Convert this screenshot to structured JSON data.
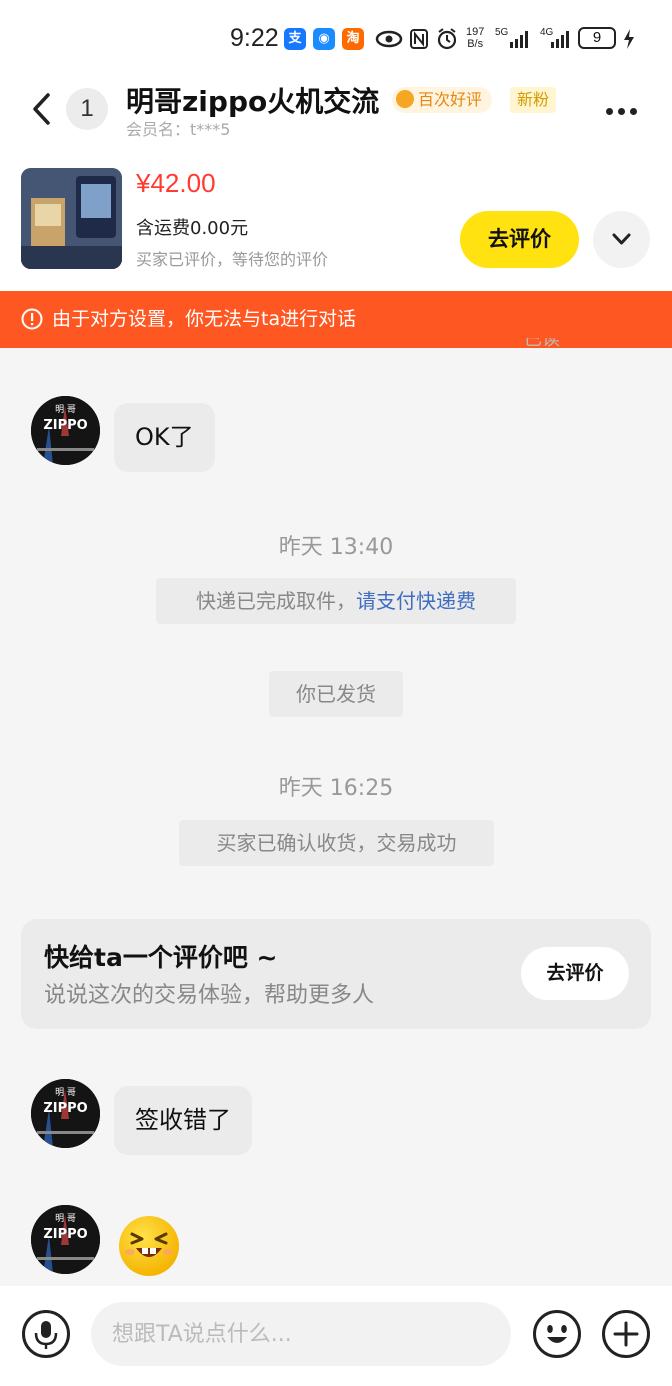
{
  "status_bar": {
    "time": "9:22",
    "app_icons": [
      {
        "name": "alipay-icon",
        "glyph": "支",
        "color": "#1677ff"
      },
      {
        "name": "qq-icon",
        "glyph": "◉",
        "color": "#1a8cff"
      },
      {
        "name": "taobao-icon",
        "glyph": "淘",
        "color": "#ff6a00"
      }
    ],
    "net_speed_value": "197",
    "net_speed_unit": "B/s",
    "net_5g": "5G",
    "net_4g": "4G",
    "battery": "9"
  },
  "header": {
    "unread_count": "1",
    "shop_name": "明哥zippo火机交流",
    "good_review_badge": "百次好评",
    "new_fan_badge": "新粉",
    "member_label": "会员名：t***5"
  },
  "product": {
    "price": "¥42.00",
    "shipping": "含运费0.00元",
    "status": "买家已评价，等待您的评价",
    "review_button": "去评价"
  },
  "banner": {
    "text": "由于对方设置，你无法与ta进行对话"
  },
  "chat": {
    "clipped_text": "已读",
    "avatar_text_top": "明 哥",
    "avatar_text_brand": "ZIPPO",
    "messages": [
      {
        "text": "OK了"
      },
      {
        "text": "签收错了"
      }
    ],
    "timestamps": [
      "昨天 13:40",
      "昨天 16:25"
    ],
    "system": {
      "pickup_prefix": "快递已完成取件，",
      "pickup_link": "请支付快递费",
      "shipped": "你已发货",
      "confirmed": "买家已确认收货，交易成功"
    },
    "review_card": {
      "title": "快给ta一个评价吧 ~",
      "subtitle": "说说这次的交易体验，帮助更多人",
      "button": "去评价"
    }
  },
  "input_bar": {
    "placeholder": "想跟TA说点什么..."
  },
  "colors": {
    "accent_yellow": "#ffe20f",
    "price_red": "#ff3b2f",
    "banner_orange": "#ff5722",
    "link_blue": "#3f6dc0"
  }
}
